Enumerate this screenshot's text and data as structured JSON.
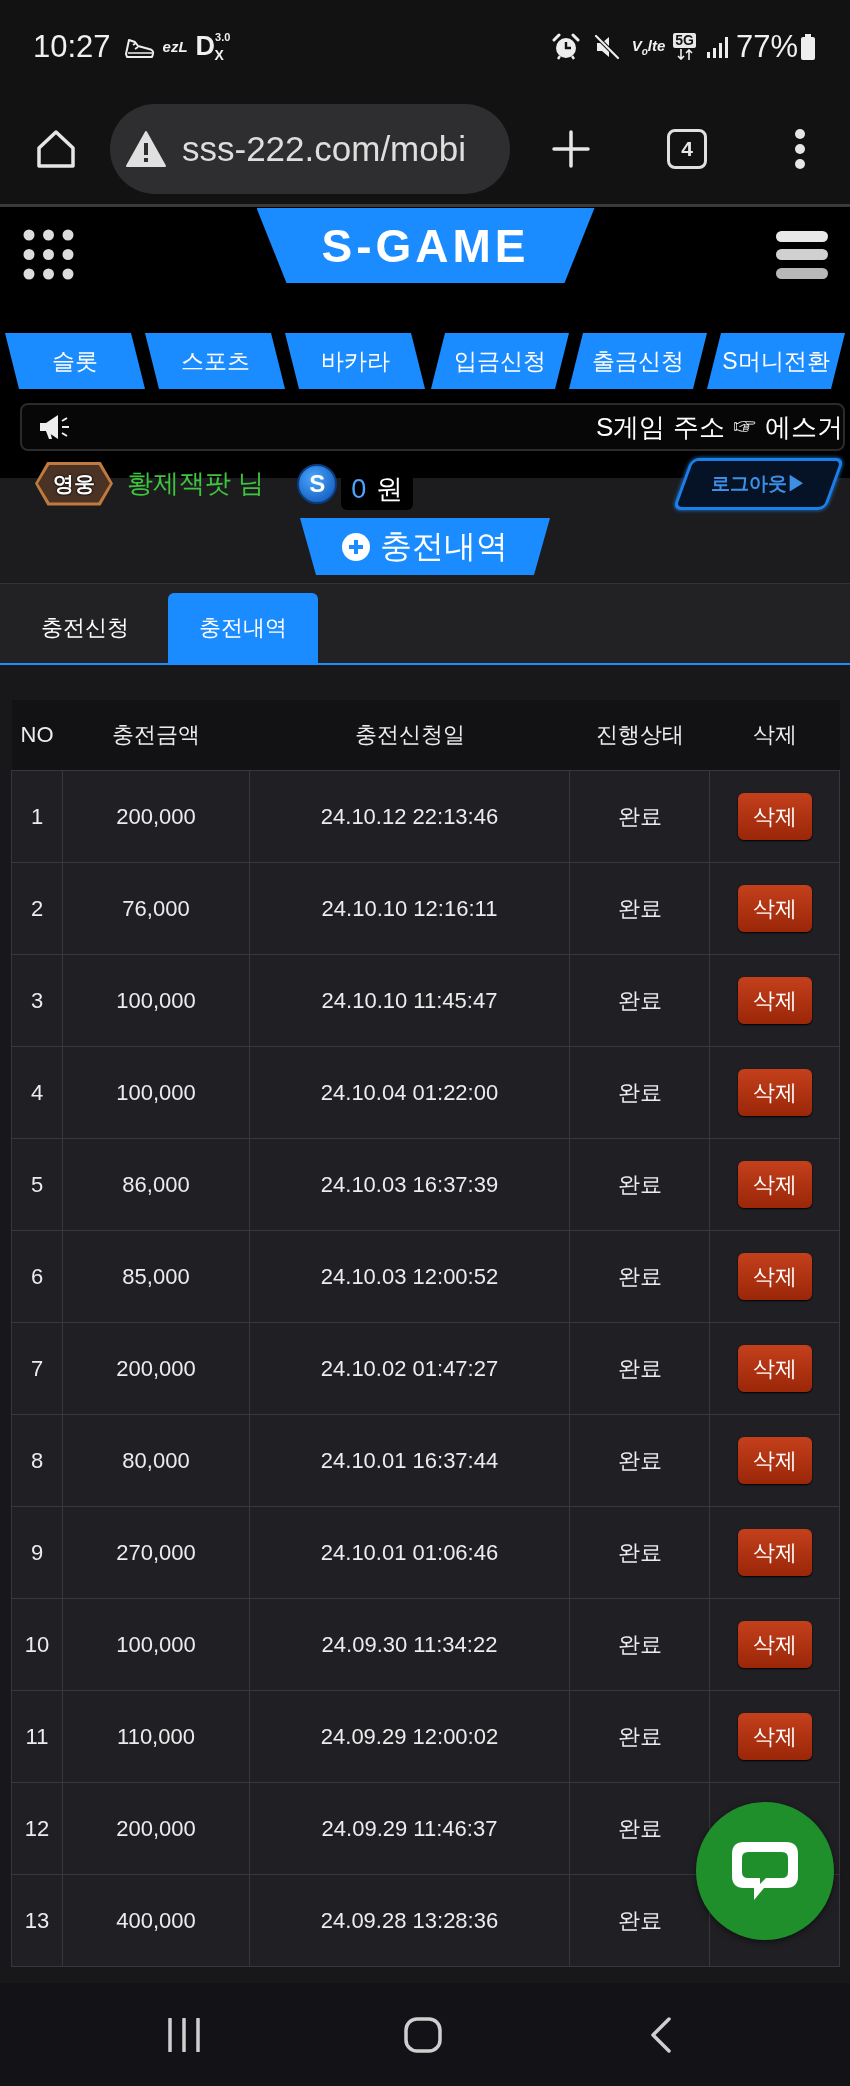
{
  "status_bar": {
    "time": "10:27",
    "notification_labels": [
      "ezL",
      "D$^{3.0}$$_{X}$"
    ],
    "network_labels": [
      {
        "kind": "plain",
        "text": "V$_{o}$lte"
      },
      {
        "kind": "boxed",
        "text": "5G"
      }
    ],
    "battery": "77%"
  },
  "browser": {
    "url": "sss-222.com/mobi",
    "tab_count": "4"
  },
  "header": {
    "logo": "S-GAME",
    "game_menu": [
      "슬롯",
      "스포츠",
      "바카라"
    ],
    "account_menu": [
      "입금신청",
      "출금신청",
      "S머니전환"
    ],
    "notice": "S게임 주소 ☞ 에스거"
  },
  "user": {
    "level": "영웅",
    "name": "황제잭팟 님",
    "coin_symbol": "S",
    "balance": "0",
    "currency": "원",
    "logout": "로그아웃▶"
  },
  "page_title": "충전내역",
  "tabs": [
    {
      "label": "충전신청",
      "selected": false
    },
    {
      "label": "충전내역",
      "selected": true
    }
  ],
  "table": {
    "columns": [
      "NO",
      "충전금액",
      "충전신청일",
      "진행상태",
      "삭제"
    ],
    "rows": [
      {
        "no": "1",
        "amount": "200,000",
        "date": "24.10.12 22:13:46",
        "status": "완료",
        "delete": "삭제"
      },
      {
        "no": "2",
        "amount": "76,000",
        "date": "24.10.10 12:16:11",
        "status": "완료",
        "delete": "삭제"
      },
      {
        "no": "3",
        "amount": "100,000",
        "date": "24.10.10 11:45:47",
        "status": "완료",
        "delete": "삭제"
      },
      {
        "no": "4",
        "amount": "100,000",
        "date": "24.10.04 01:22:00",
        "status": "완료",
        "delete": "삭제"
      },
      {
        "no": "5",
        "amount": "86,000",
        "date": "24.10.03 16:37:39",
        "status": "완료",
        "delete": "삭제"
      },
      {
        "no": "6",
        "amount": "85,000",
        "date": "24.10.03 12:00:52",
        "status": "완료",
        "delete": "삭제"
      },
      {
        "no": "7",
        "amount": "200,000",
        "date": "24.10.02 01:47:27",
        "status": "완료",
        "delete": "삭제"
      },
      {
        "no": "8",
        "amount": "80,000",
        "date": "24.10.01 16:37:44",
        "status": "완료",
        "delete": "삭제"
      },
      {
        "no": "9",
        "amount": "270,000",
        "date": "24.10.01 01:06:46",
        "status": "완료",
        "delete": "삭제"
      },
      {
        "no": "10",
        "amount": "100,000",
        "date": "24.09.30 11:34:22",
        "status": "완료",
        "delete": "삭제"
      },
      {
        "no": "11",
        "amount": "110,000",
        "date": "24.09.29 12:00:02",
        "status": "완료",
        "delete": "삭제"
      },
      {
        "no": "12",
        "amount": "200,000",
        "date": "24.09.29 11:46:37",
        "status": "완료"
      },
      {
        "no": "13",
        "amount": "400,000",
        "date": "24.09.28 13:28:36",
        "status": "완료"
      }
    ]
  }
}
